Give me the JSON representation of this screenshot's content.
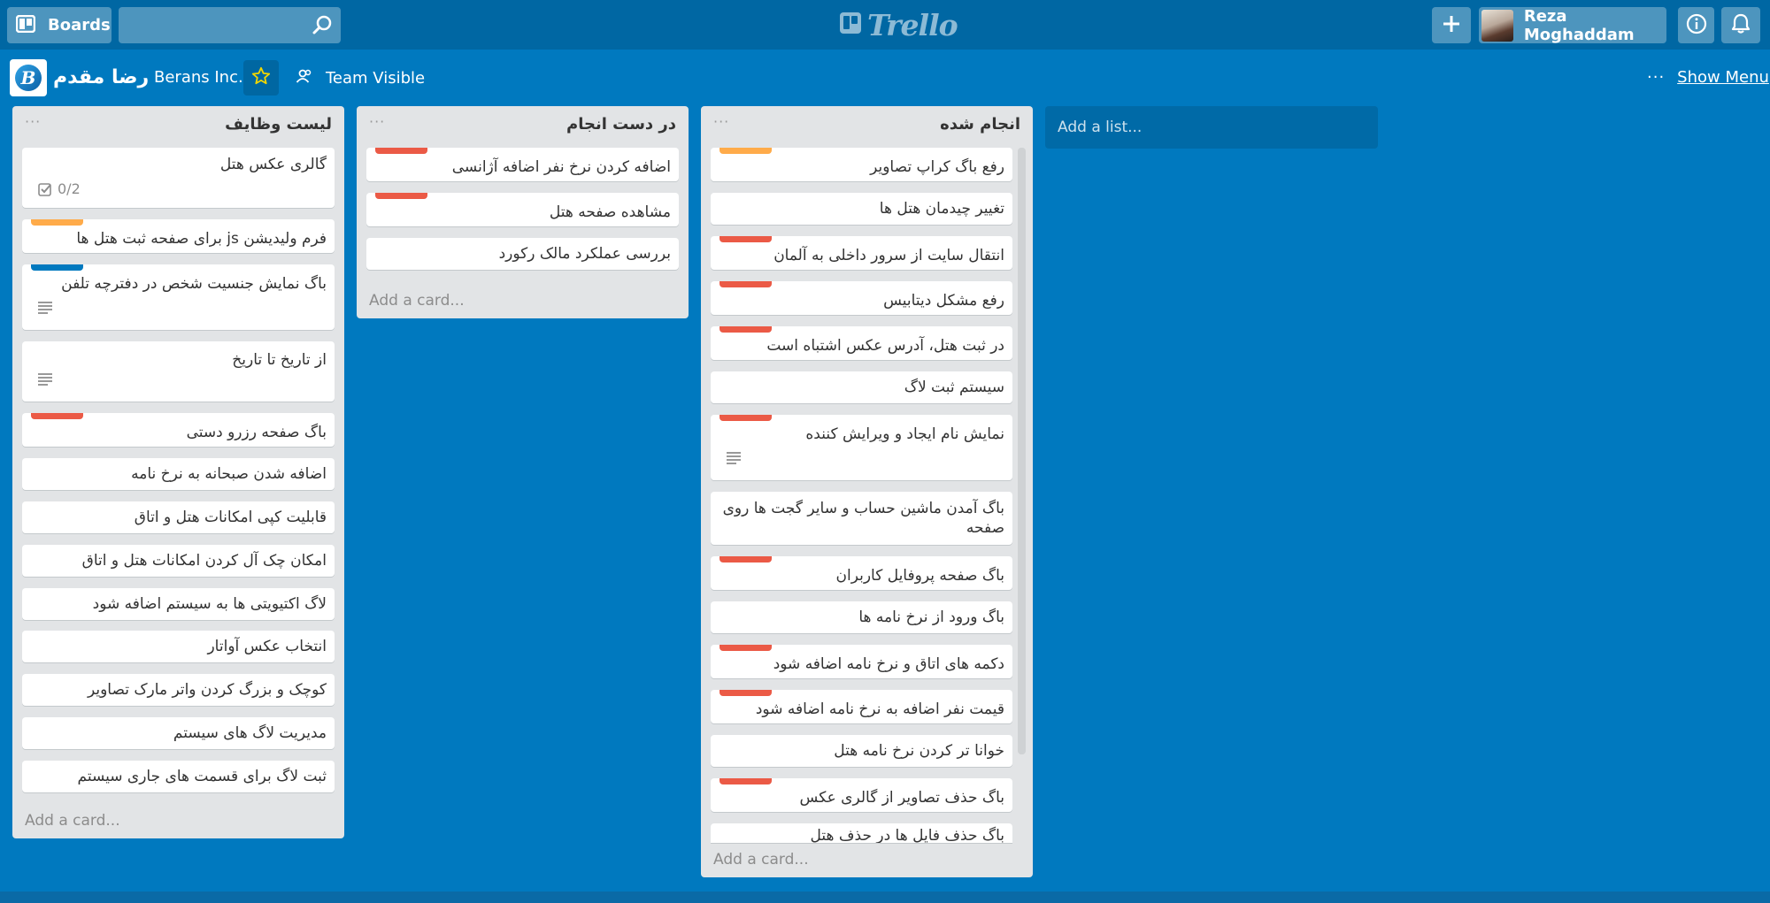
{
  "header": {
    "boards_label": "Boards",
    "search_placeholder": "",
    "logo_text": "Trello",
    "member_name": "Reza Moghaddam"
  },
  "board": {
    "title": "رضا مقدم",
    "org": "Berans Inc.",
    "visibility": "Team Visible",
    "show_menu": "Show Menu",
    "menu_dots": "···"
  },
  "colors": {
    "background": "#0079bf",
    "header": "#0067a3",
    "label_red": "#eb5a46",
    "label_orange": "#ffab4a",
    "label_blue": "#0079bf"
  },
  "lists": [
    {
      "title": "لیست وظایف",
      "menu": "···",
      "add_card": "Add a card...",
      "cards": [
        {
          "text": "گالری عکس هتل",
          "checklist": "0/2"
        },
        {
          "text": "فرم ولیدیشن js برای صفحه ثبت هتل ها",
          "label": "orange"
        },
        {
          "text": "باگ نمایش جنسیت شخص در دفترچه تلفن",
          "label": "blue",
          "description": true
        },
        {
          "text": "از تاریخ تا تاریخ",
          "description": true
        },
        {
          "text": "باگ صفحه رزرو دستی",
          "label": "red"
        },
        {
          "text": "اضافه شدن صبحانه به نرخ نامه"
        },
        {
          "text": "قابلیت کپی امکانات هتل و اتاق"
        },
        {
          "text": "امکان چک آل کردن امکانات هتل و اتاق"
        },
        {
          "text": "لاگ اکتیویتی ها به سیستم اضافه شود"
        },
        {
          "text": "انتخاب عکس آواتار"
        },
        {
          "text": "کوچک و بزرگ کردن واتر مارک تصاویر"
        },
        {
          "text": "مدیریت لاگ های سیستم"
        },
        {
          "text": "ثبت لاگ برای قسمت های جاری سیستم"
        }
      ]
    },
    {
      "title": "در دست انجام",
      "menu": "···",
      "add_card": "Add a card...",
      "cards": [
        {
          "text": "اضافه کردن نرخ نفر اضافه آژانسی",
          "label": "red"
        },
        {
          "text": "مشاهده صفحه هتل",
          "label": "red"
        },
        {
          "text": "بررسی عملکرد مالک رکورد"
        }
      ]
    },
    {
      "title": "انجام شده",
      "menu": "···",
      "add_card": "Add a card...",
      "cards": [
        {
          "text": "رفع باگ کراپ تصاویر",
          "label": "orange"
        },
        {
          "text": "تغییر چیدمان هتل ها"
        },
        {
          "text": "انتقال سایت از سرور داخلی به آلمان",
          "label": "red"
        },
        {
          "text": "رفع مشکل دیتابیس",
          "label": "red"
        },
        {
          "text": "در ثبت هتل، آدرس عکس اشتباه است",
          "label": "red"
        },
        {
          "text": "سیستم ثبت لاگ"
        },
        {
          "text": "نمایش نام ایجاد و ویرایش کننده",
          "label": "red",
          "description": true
        },
        {
          "text": "باگ آمدن ماشین حساب و سایر گجت ها روی صفحه"
        },
        {
          "text": "باگ صفحه پروفایل کاربران",
          "label": "red"
        },
        {
          "text": "باگ ورود از نرخ نامه ها"
        },
        {
          "text": "دکمه های اتاق و نرخ نامه اضافه شود",
          "label": "red"
        },
        {
          "text": "قیمت نفر اضافه به نرخ نامه اضافه شود",
          "label": "red"
        },
        {
          "text": "خوانا تر کردن نرخ نامه هتل"
        },
        {
          "text": "باگ حذف تصاویر از گالری عکس",
          "label": "red"
        },
        {
          "text": "باگ حذف فایل ها در حذف هتل"
        }
      ]
    }
  ],
  "add_list": "Add a list..."
}
